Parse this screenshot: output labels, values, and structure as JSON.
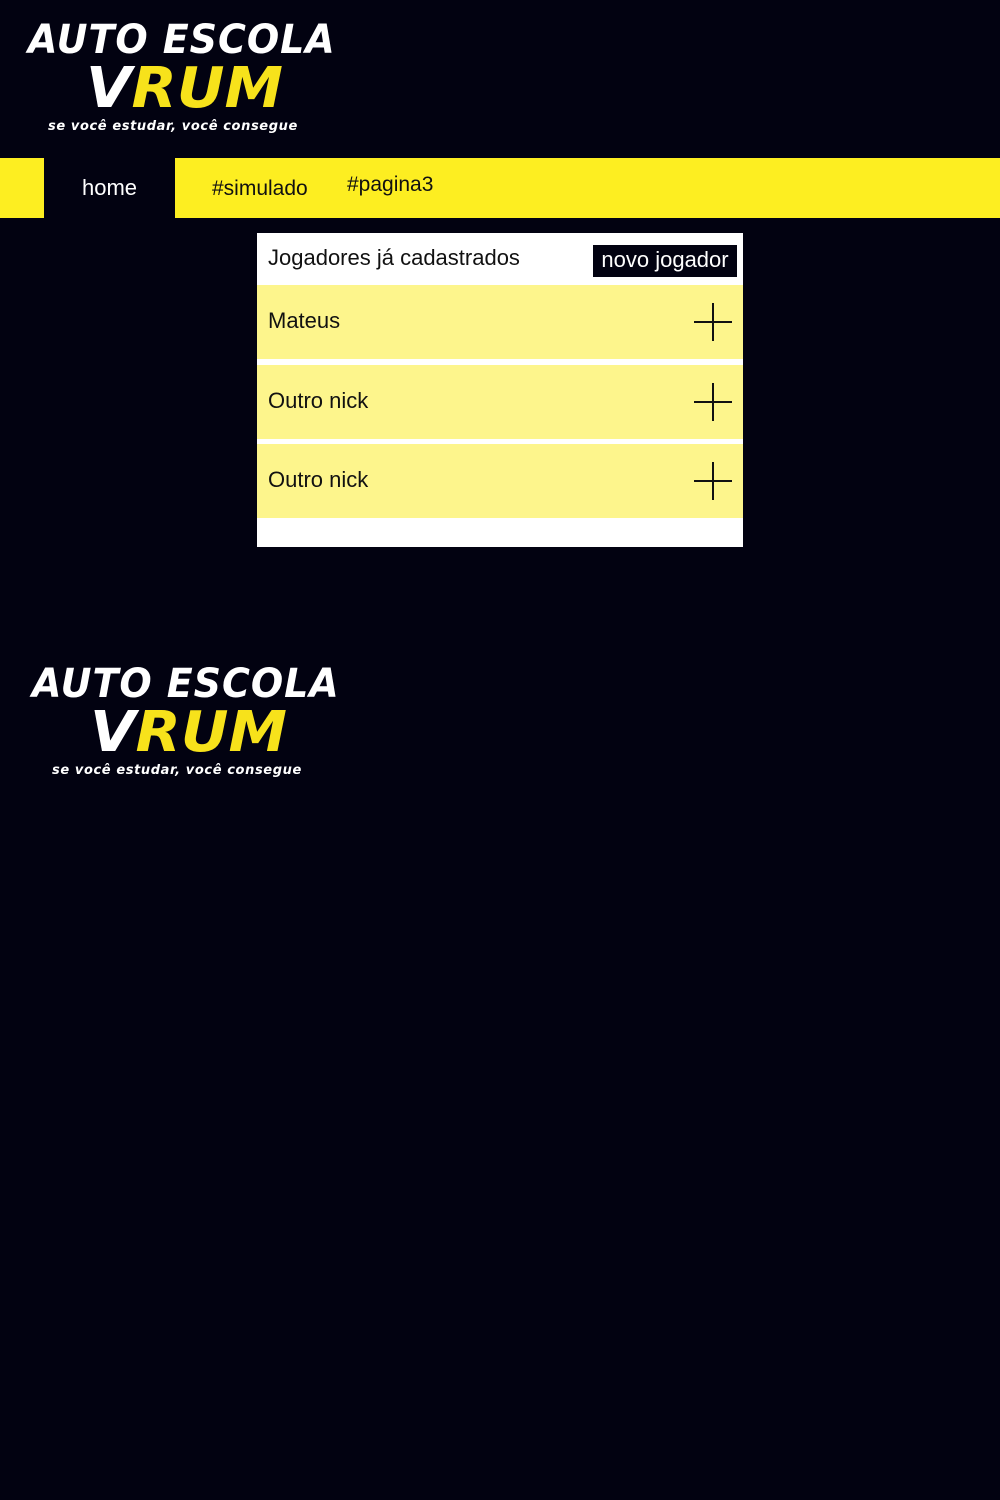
{
  "logo": {
    "line1": "AUTO ESCOLA",
    "line2_v": "V",
    "line2_rest": "RUM",
    "tagline": "se você estudar, você consegue"
  },
  "nav": {
    "home": "home",
    "simulado": "#simulado",
    "pagina3": "#pagina3"
  },
  "players_panel": {
    "title": "Jogadores já cadastrados",
    "new_player_button": "novo jogador",
    "players": [
      {
        "name": "Mateus",
        "action_icon": "plus-icon"
      },
      {
        "name": "Outro nick",
        "action_icon": "plus-icon"
      },
      {
        "name": "Outro nick",
        "action_icon": "plus-icon"
      }
    ]
  },
  "colors": {
    "background": "#020211",
    "accent_yellow": "#fdee21",
    "row_yellow": "#fdf58c",
    "panel_white": "#ffffff"
  }
}
